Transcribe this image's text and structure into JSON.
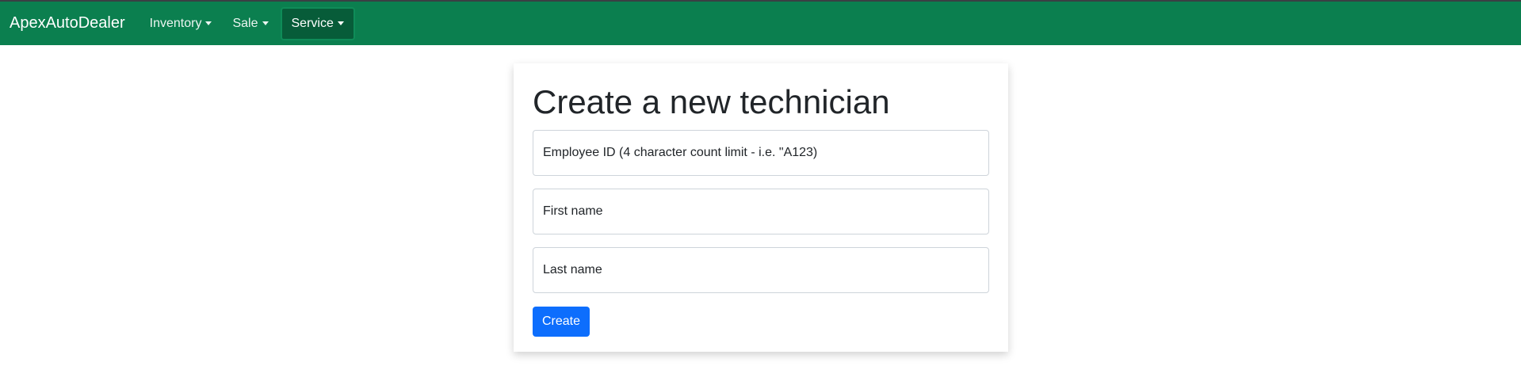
{
  "navbar": {
    "brand": "ApexAutoDealer",
    "items": [
      {
        "label": "Inventory",
        "active": false
      },
      {
        "label": "Sale",
        "active": false
      },
      {
        "label": "Service",
        "active": true
      }
    ],
    "background_color": "#0b7f4f"
  },
  "form": {
    "title": "Create a new technician",
    "fields": [
      {
        "placeholder": "Employee ID (4 character count limit - i.e. \"A123)",
        "value": ""
      },
      {
        "placeholder": "First name",
        "value": ""
      },
      {
        "placeholder": "Last name",
        "value": ""
      }
    ],
    "submit_label": "Create",
    "submit_color": "#0d6efd"
  }
}
